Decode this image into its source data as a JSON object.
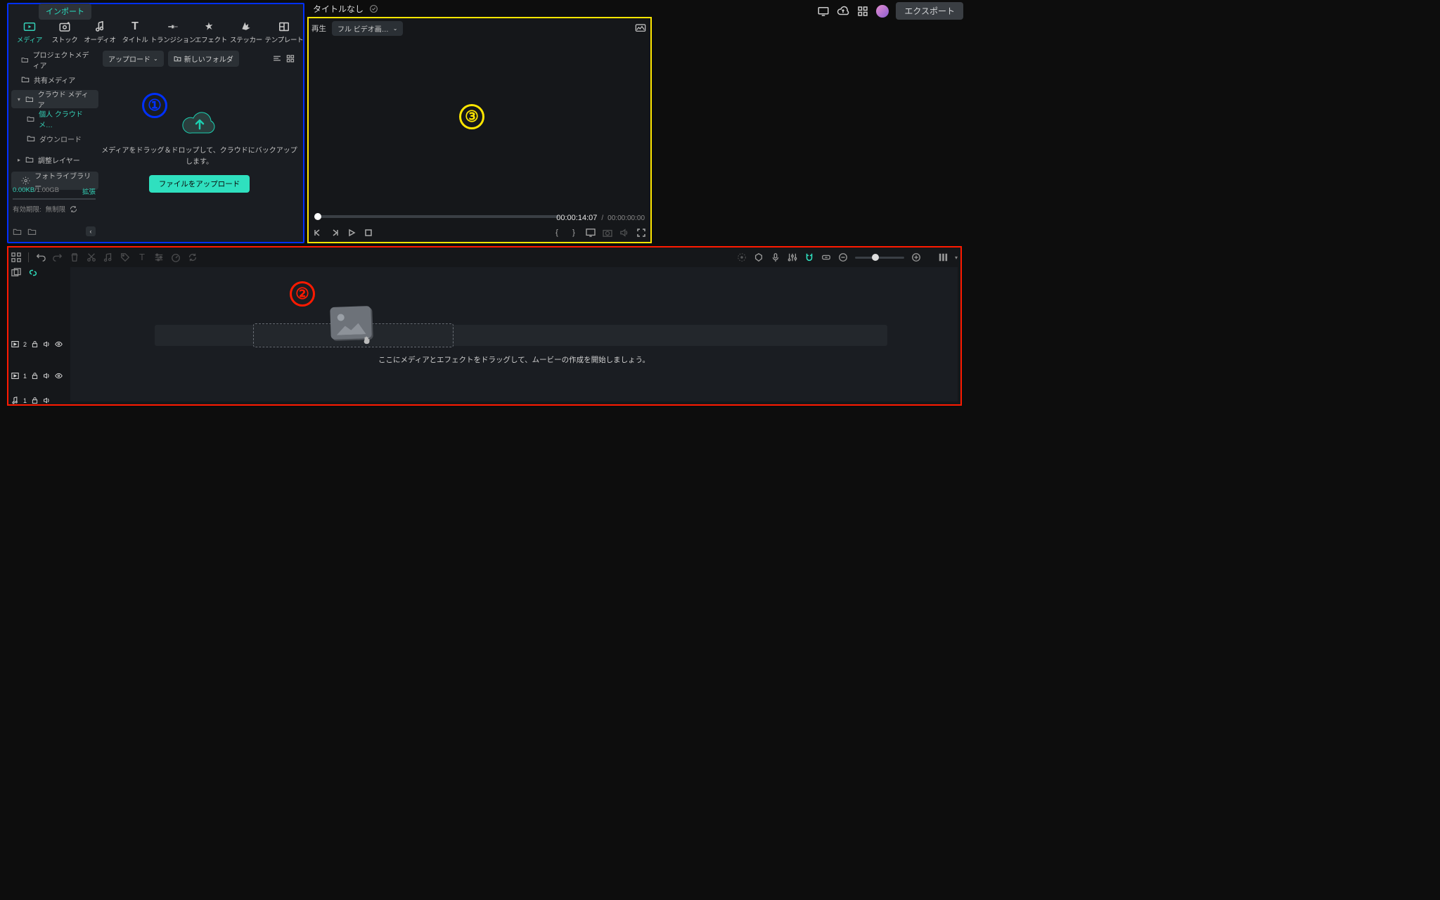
{
  "header": {
    "project_title": "タイトルなし",
    "export_label": "エクスポート"
  },
  "media_panel": {
    "import_label": "インポート",
    "tabs": [
      {
        "label": "メディア",
        "icon": "media"
      },
      {
        "label": "ストック",
        "icon": "stock"
      },
      {
        "label": "オーディオ",
        "icon": "audio"
      },
      {
        "label": "タイトル",
        "icon": "title"
      },
      {
        "label": "トランジション",
        "icon": "transition"
      },
      {
        "label": "エフェクト",
        "icon": "effect"
      },
      {
        "label": "ステッカー",
        "icon": "sticker"
      },
      {
        "label": "テンプレート",
        "icon": "template"
      }
    ],
    "tree": {
      "project_media": "プロジェクトメディア",
      "shared_media": "共有メディア",
      "cloud_media": "クラウド メディア",
      "personal_cloud": "個人 クラウド メ…",
      "download": "ダウンロード",
      "adjustment_layer": "調整レイヤー",
      "photo_library": "フォトライブラリー"
    },
    "toolbar": {
      "upload_label": "アップロード",
      "new_folder_label": "新しいフォルダ"
    },
    "dropzone": {
      "message": "メディアをドラッグ＆ドロップして、クラウドにバックアップします。",
      "button": "ファイルをアップロード"
    },
    "storage": {
      "used": "0.00KB",
      "total": "1.00GB",
      "expand": "拡張",
      "expiry_label": "有効期限:",
      "expiry_value": "無制限"
    }
  },
  "preview": {
    "play_label": "再生",
    "mode_label": "フル ビデオ画…",
    "current_time": "00:00:14:07",
    "separator": "/",
    "duration": "00:00:00:00"
  },
  "timeline": {
    "drop_hint": "ここにメディアとエフェクトをドラッグして、ムービーの作成を開始しましょう。",
    "tracks": {
      "video2": "2",
      "video1": "1",
      "audio1": "1"
    }
  },
  "callouts": {
    "one": "①",
    "two": "②",
    "three": "③"
  }
}
